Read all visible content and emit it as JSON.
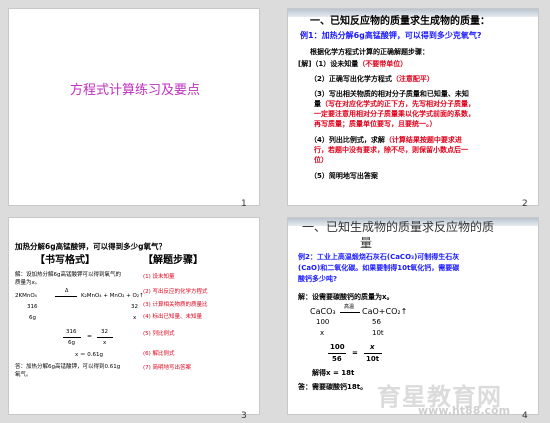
{
  "slide1": {
    "title": "方程式计算练习及要点",
    "number": "1"
  },
  "slide2": {
    "number": "2",
    "heading": "一、已知反应物的质量求生成物的质量：",
    "example": "例1：加热分解6g高锰酸钾，可以得到多少克氧气?",
    "steps_title": "根据化学方程式计算的正确解题步骤：",
    "step1_a": "[解]（1）设未知量",
    "step1_b": "（不要带单位）",
    "step2_a": "（2）正确写出化学方程式",
    "step2_b": "（注意配平）",
    "step3_l1": "（3）写出相关物质的相对分子质量和已知量、未知",
    "step3_l2": "量",
    "step3_l2_red": "（写在对应化学式的正下方，先写相对分子质量，",
    "step3_l3": "一定要注意用相对分子质量乘以化学式前面的系数，",
    "step3_l4": "再写质量；质量单位要写，且要统一。）",
    "step4_a": "（4）列出比例式，求解",
    "step4_b": "（计算结果按题中要求进",
    "step4_l2": "行，若题中没有要求，除不尽，则保留小数点后一",
    "step4_l3": "位）",
    "step5": "（5）简明地写出答案"
  },
  "slide3": {
    "number": "3",
    "question": "加热分解6g高锰酸钾，可以得到多少g氧气？",
    "left_header": "【书写格式】",
    "right_header": "【解题步骤】",
    "ans_l1": "解：设加热分解6g高锰酸钾可以得到氧气的",
    "ans_l2": "质量为x。",
    "eq_lhs": "2KMnO₄",
    "eq_cond": "Δ",
    "eq_rhs": "K₂MnO₄ + MnO₂ + O₂↑",
    "mr_left": "316",
    "mr_right": "32",
    "mass_left": "6g",
    "mass_right": "x",
    "frac1_num": "316",
    "frac1_den": "6g",
    "eq_sign": "=",
    "frac2_num": "32",
    "frac2_den": "x",
    "result": "x ＝ 0.61g",
    "answer_l1": "答：加热分解6g高锰酸钾，可以得到0.61g",
    "answer_l2": "氧气。",
    "steps": [
      "(1) 设未知量",
      "(2) 写出反应的化学方程式",
      "(3) 计算相关物质的质量比",
      "(4) 标出已知量、未知量",
      "(5) 列比例式",
      "(6) 解比例式",
      "(7) 简明地写出答案"
    ]
  },
  "slide4": {
    "number": "4",
    "heading_l1": "一、已知生成物的质量求反应物的质",
    "heading_l2": "量",
    "example_l1": "例2：工业上高温煅烧石灰石(CaCO₃)可制得生石灰",
    "example_l2": "(CaO)和二氧化碳。如果要制得10t氧化钙，需要碳",
    "example_l3": "酸钙多少吨?",
    "solve": "解：设需要碳酸钙的质量为x。",
    "eq_lhs": "CaCO₃",
    "eq_cond": "高温",
    "eq_rhs": "CaO+CO₂↑",
    "mr_left": "100",
    "mr_right": "56",
    "mass_left": "x",
    "mass_right": "10t",
    "frac1_num": "100",
    "frac1_den": "56",
    "eq_sign": "=",
    "frac2_num": "x",
    "frac2_den": "10t",
    "result": "解得x = 18t",
    "answer": "答：需要碳酸钙18t。"
  },
  "watermark": {
    "brand": "育星教育网",
    "url": "www.ht88.com"
  }
}
